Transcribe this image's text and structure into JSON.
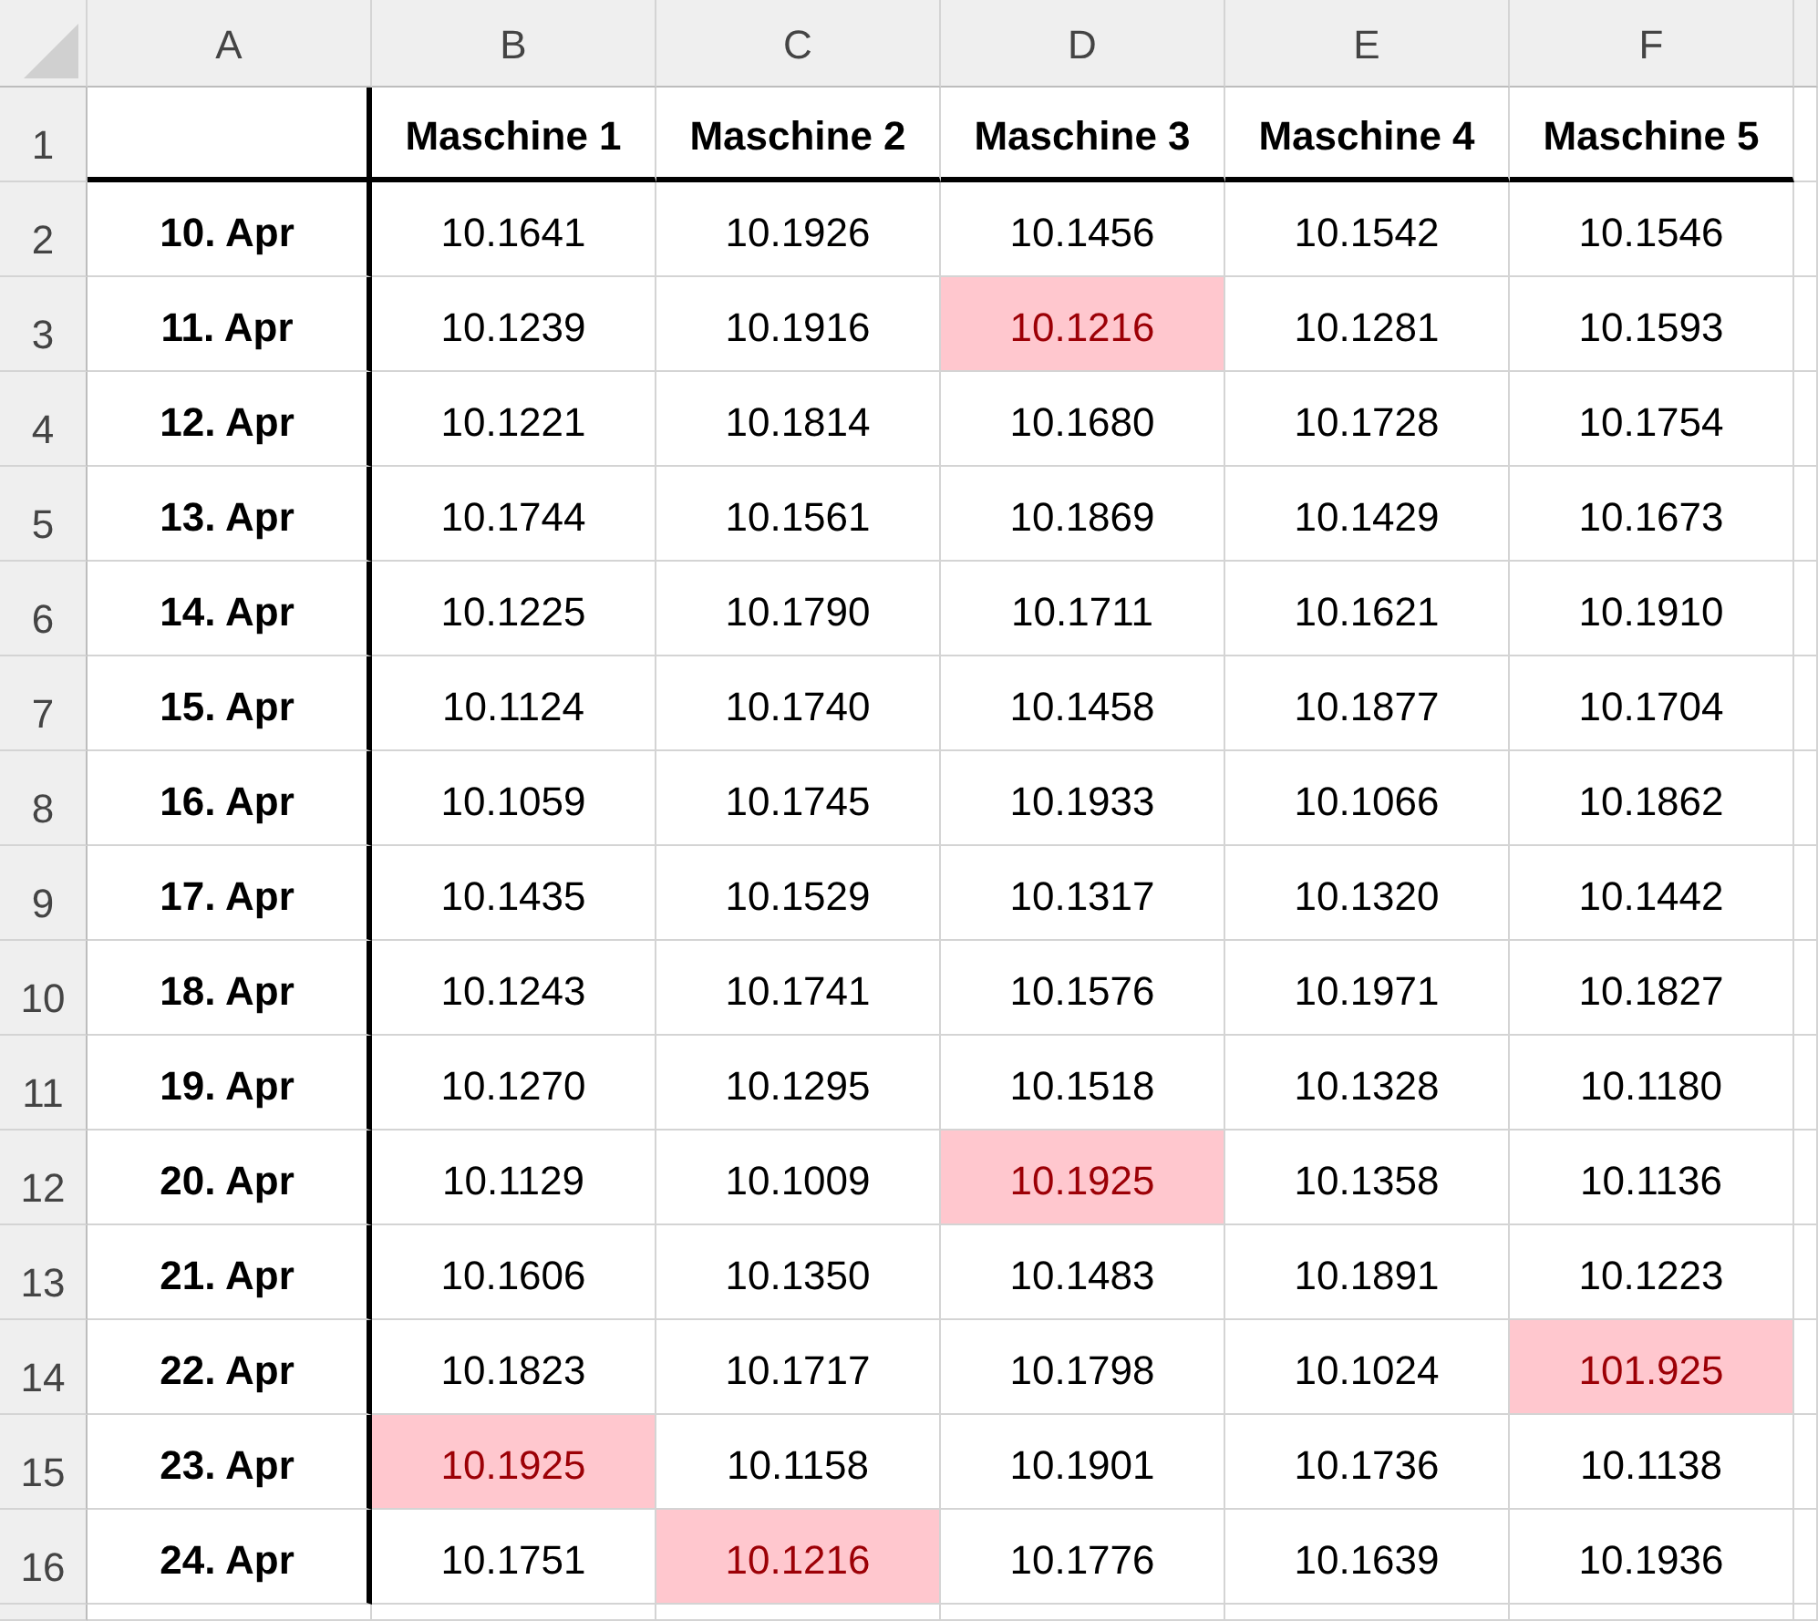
{
  "column_headers": [
    "A",
    "B",
    "C",
    "D",
    "E",
    "F"
  ],
  "rows": [
    {
      "number": "1",
      "kind": "header",
      "headings": [
        "Maschine 1",
        "Maschine 2",
        "Maschine 3",
        "Maschine 4",
        "Maschine 5"
      ]
    },
    {
      "number": "2",
      "kind": "data",
      "date": "10. Apr",
      "values": [
        {
          "text": "10.1641",
          "flagged": false
        },
        {
          "text": "10.1926",
          "flagged": false
        },
        {
          "text": "10.1456",
          "flagged": false
        },
        {
          "text": "10.1542",
          "flagged": false
        },
        {
          "text": "10.1546",
          "flagged": false
        }
      ]
    },
    {
      "number": "3",
      "kind": "data",
      "date": "11. Apr",
      "values": [
        {
          "text": "10.1239",
          "flagged": false
        },
        {
          "text": "10.1916",
          "flagged": false
        },
        {
          "text": "10.1216",
          "flagged": true
        },
        {
          "text": "10.1281",
          "flagged": false
        },
        {
          "text": "10.1593",
          "flagged": false
        }
      ]
    },
    {
      "number": "4",
      "kind": "data",
      "date": "12. Apr",
      "values": [
        {
          "text": "10.1221",
          "flagged": false
        },
        {
          "text": "10.1814",
          "flagged": false
        },
        {
          "text": "10.1680",
          "flagged": false
        },
        {
          "text": "10.1728",
          "flagged": false
        },
        {
          "text": "10.1754",
          "flagged": false
        }
      ]
    },
    {
      "number": "5",
      "kind": "data",
      "date": "13. Apr",
      "values": [
        {
          "text": "10.1744",
          "flagged": false
        },
        {
          "text": "10.1561",
          "flagged": false
        },
        {
          "text": "10.1869",
          "flagged": false
        },
        {
          "text": "10.1429",
          "flagged": false
        },
        {
          "text": "10.1673",
          "flagged": false
        }
      ]
    },
    {
      "number": "6",
      "kind": "data",
      "date": "14. Apr",
      "values": [
        {
          "text": "10.1225",
          "flagged": false
        },
        {
          "text": "10.1790",
          "flagged": false
        },
        {
          "text": "10.1711",
          "flagged": false
        },
        {
          "text": "10.1621",
          "flagged": false
        },
        {
          "text": "10.1910",
          "flagged": false
        }
      ]
    },
    {
      "number": "7",
      "kind": "data",
      "date": "15. Apr",
      "values": [
        {
          "text": "10.1124",
          "flagged": false
        },
        {
          "text": "10.1740",
          "flagged": false
        },
        {
          "text": "10.1458",
          "flagged": false
        },
        {
          "text": "10.1877",
          "flagged": false
        },
        {
          "text": "10.1704",
          "flagged": false
        }
      ]
    },
    {
      "number": "8",
      "kind": "data",
      "date": "16. Apr",
      "values": [
        {
          "text": "10.1059",
          "flagged": false
        },
        {
          "text": "10.1745",
          "flagged": false
        },
        {
          "text": "10.1933",
          "flagged": false
        },
        {
          "text": "10.1066",
          "flagged": false
        },
        {
          "text": "10.1862",
          "flagged": false
        }
      ]
    },
    {
      "number": "9",
      "kind": "data",
      "date": "17. Apr",
      "values": [
        {
          "text": "10.1435",
          "flagged": false
        },
        {
          "text": "10.1529",
          "flagged": false
        },
        {
          "text": "10.1317",
          "flagged": false
        },
        {
          "text": "10.1320",
          "flagged": false
        },
        {
          "text": "10.1442",
          "flagged": false
        }
      ]
    },
    {
      "number": "10",
      "kind": "data",
      "date": "18. Apr",
      "values": [
        {
          "text": "10.1243",
          "flagged": false
        },
        {
          "text": "10.1741",
          "flagged": false
        },
        {
          "text": "10.1576",
          "flagged": false
        },
        {
          "text": "10.1971",
          "flagged": false
        },
        {
          "text": "10.1827",
          "flagged": false
        }
      ]
    },
    {
      "number": "11",
      "kind": "data",
      "date": "19. Apr",
      "values": [
        {
          "text": "10.1270",
          "flagged": false
        },
        {
          "text": "10.1295",
          "flagged": false
        },
        {
          "text": "10.1518",
          "flagged": false
        },
        {
          "text": "10.1328",
          "flagged": false
        },
        {
          "text": "10.1180",
          "flagged": false
        }
      ]
    },
    {
      "number": "12",
      "kind": "data",
      "date": "20. Apr",
      "values": [
        {
          "text": "10.1129",
          "flagged": false
        },
        {
          "text": "10.1009",
          "flagged": false
        },
        {
          "text": "10.1925",
          "flagged": true
        },
        {
          "text": "10.1358",
          "flagged": false
        },
        {
          "text": "10.1136",
          "flagged": false
        }
      ]
    },
    {
      "number": "13",
      "kind": "data",
      "date": "21. Apr",
      "values": [
        {
          "text": "10.1606",
          "flagged": false
        },
        {
          "text": "10.1350",
          "flagged": false
        },
        {
          "text": "10.1483",
          "flagged": false
        },
        {
          "text": "10.1891",
          "flagged": false
        },
        {
          "text": "10.1223",
          "flagged": false
        }
      ]
    },
    {
      "number": "14",
      "kind": "data",
      "date": "22. Apr",
      "values": [
        {
          "text": "10.1823",
          "flagged": false
        },
        {
          "text": "10.1717",
          "flagged": false
        },
        {
          "text": "10.1798",
          "flagged": false
        },
        {
          "text": "10.1024",
          "flagged": false
        },
        {
          "text": "101.925",
          "flagged": true
        }
      ]
    },
    {
      "number": "15",
      "kind": "data",
      "date": "23. Apr",
      "values": [
        {
          "text": "10.1925",
          "flagged": true
        },
        {
          "text": "10.1158",
          "flagged": false
        },
        {
          "text": "10.1901",
          "flagged": false
        },
        {
          "text": "10.1736",
          "flagged": false
        },
        {
          "text": "10.1138",
          "flagged": false
        }
      ]
    },
    {
      "number": "16",
      "kind": "data",
      "date": "24. Apr",
      "values": [
        {
          "text": "10.1751",
          "flagged": false
        },
        {
          "text": "10.1216",
          "flagged": true
        },
        {
          "text": "10.1776",
          "flagged": false
        },
        {
          "text": "10.1639",
          "flagged": false
        },
        {
          "text": "10.1936",
          "flagged": false
        }
      ]
    }
  ]
}
